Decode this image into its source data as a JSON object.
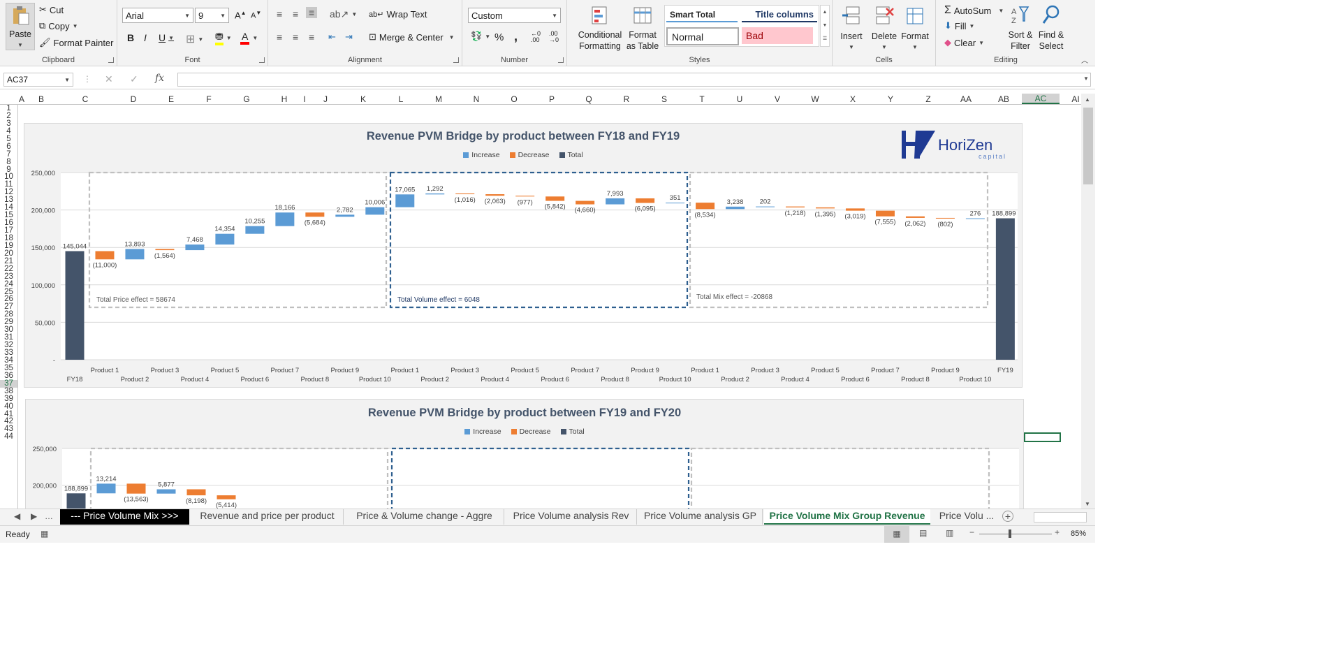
{
  "ribbon": {
    "clipboard": {
      "paste": "Paste",
      "cut": "Cut",
      "copy": "Copy",
      "format_painter": "Format Painter",
      "label": "Clipboard"
    },
    "font": {
      "name": "Arial",
      "size": "9",
      "bold": "B",
      "italic": "I",
      "underline": "U",
      "label": "Font"
    },
    "alignment": {
      "wrap": "Wrap Text",
      "merge": "Merge & Center",
      "label": "Alignment"
    },
    "number": {
      "format": "Custom",
      "percent": "%",
      "comma": ",",
      "label": "Number"
    },
    "styles": {
      "conditional": "Conditional Formatting",
      "format_table": "Format as Table",
      "smart_total": "Smart Total",
      "title_columns": "Title columns",
      "normal": "Normal",
      "bad": "Bad",
      "label": "Styles"
    },
    "cells": {
      "insert": "Insert",
      "delete": "Delete",
      "format": "Format",
      "label": "Cells"
    },
    "editing": {
      "autosum": "AutoSum",
      "fill": "Fill",
      "clear": "Clear",
      "sort": "Sort & Filter",
      "find": "Find & Select",
      "label": "Editing"
    }
  },
  "formula": {
    "name_box": "AC37",
    "fx": "fx"
  },
  "columns": [
    "A",
    "B",
    "C",
    "D",
    "E",
    "F",
    "G",
    "H",
    "I",
    "J",
    "K",
    "L",
    "M",
    "N",
    "O",
    "P",
    "Q",
    "R",
    "S",
    "T",
    "U",
    "V",
    "W",
    "X",
    "Y",
    "Z",
    "AA",
    "AB",
    "AC",
    "AI"
  ],
  "rows": [
    "1",
    "2",
    "3",
    "4",
    "5",
    "6",
    "7",
    "8",
    "9",
    "10",
    "11",
    "12",
    "13",
    "14",
    "15",
    "16",
    "17",
    "18",
    "19",
    "20",
    "21",
    "22",
    "23",
    "24",
    "25",
    "26",
    "27",
    "28",
    "29",
    "30",
    "31",
    "32",
    "33",
    "34",
    "35",
    "36",
    "37",
    "38",
    "39",
    "40",
    "41",
    "42",
    "43",
    "44"
  ],
  "logo": {
    "main": "HoriZen",
    "sub": "capital"
  },
  "chart_data": [
    {
      "type": "bar",
      "title": "Revenue PVM Bridge by product between FY18 and FY19",
      "legend": [
        "Increase",
        "Decrease",
        "Total"
      ],
      "colors": {
        "increase": "#5b9bd5",
        "decrease": "#ed7d31",
        "total": "#44546a"
      },
      "ylim": [
        0,
        250000
      ],
      "yticks": [
        "250,000",
        "200,000",
        "150,000",
        "100,000",
        "50,000",
        "-"
      ],
      "categories": [
        "FY18",
        "Product 1",
        "Product 2",
        "Product 3",
        "Product 4",
        "Product 5",
        "Product 6",
        "Product 7",
        "Product 8",
        "Product 9",
        "Product 10",
        "Product 1",
        "Product 2",
        "Product 3",
        "Product 4",
        "Product 5",
        "Product 6",
        "Product 7",
        "Product 8",
        "Product 9",
        "Product 10",
        "Product 1",
        "Product 2",
        "Product 3",
        "Product 4",
        "Product 5",
        "Product 6",
        "Product 7",
        "Product 8",
        "Product 9",
        "Product 10",
        "FY19"
      ],
      "values": [
        145044,
        -11000,
        13893,
        -1564,
        7468,
        14354,
        10255,
        18166,
        -5684,
        2782,
        10006,
        17065,
        1292,
        -1016,
        -2063,
        -977,
        -5842,
        -4660,
        7993,
        -6095,
        351,
        -8534,
        3238,
        202,
        -1218,
        -1395,
        -3019,
        -7555,
        -2062,
        -802,
        276,
        188899
      ],
      "labels": [
        "145,044",
        "(11,000)",
        "13,893",
        "(1,564)",
        "7,468",
        "14,354",
        "10,255",
        "18,166",
        "(5,684)",
        "2,782",
        "10,006",
        "17,065",
        "1,292",
        "(1,016)",
        "(2,063)",
        "(977)",
        "(5,842)",
        "(4,660)",
        "7,993",
        "(6,095)",
        "351",
        "(8,534)",
        "3,238",
        "202",
        "(1,218)",
        "(1,395)",
        "(3,019)",
        "(7,555)",
        "(2,062)",
        "(802)",
        "276",
        "188,899"
      ],
      "annotations": [
        "Total Price effect = 58674",
        "Total Volume effect = 6048",
        "Total Mix effect = -20868"
      ]
    },
    {
      "type": "bar",
      "title": "Revenue PVM Bridge by product between FY19 and FY20",
      "legend": [
        "Increase",
        "Decrease",
        "Total"
      ],
      "ylim": [
        0,
        250000
      ],
      "yticks": [
        "250,000",
        "200,000"
      ],
      "values": [
        188899,
        13214,
        -13563,
        5877,
        -8198,
        -5414
      ],
      "labels": [
        "188,899",
        "13,214",
        "(13,563)",
        "5,877",
        "(8,198)",
        "(5,414)"
      ]
    }
  ],
  "tabs": [
    "--- Price Volume Mix >>>",
    "Revenue and price per product",
    "Price & Volume change - Aggre",
    "Price Volume analysis Rev",
    "Price Volume analysis GP",
    "Price Volume Mix Group Revenue",
    "Price Volu ..."
  ],
  "status": {
    "ready": "Ready",
    "zoom": "85%"
  }
}
